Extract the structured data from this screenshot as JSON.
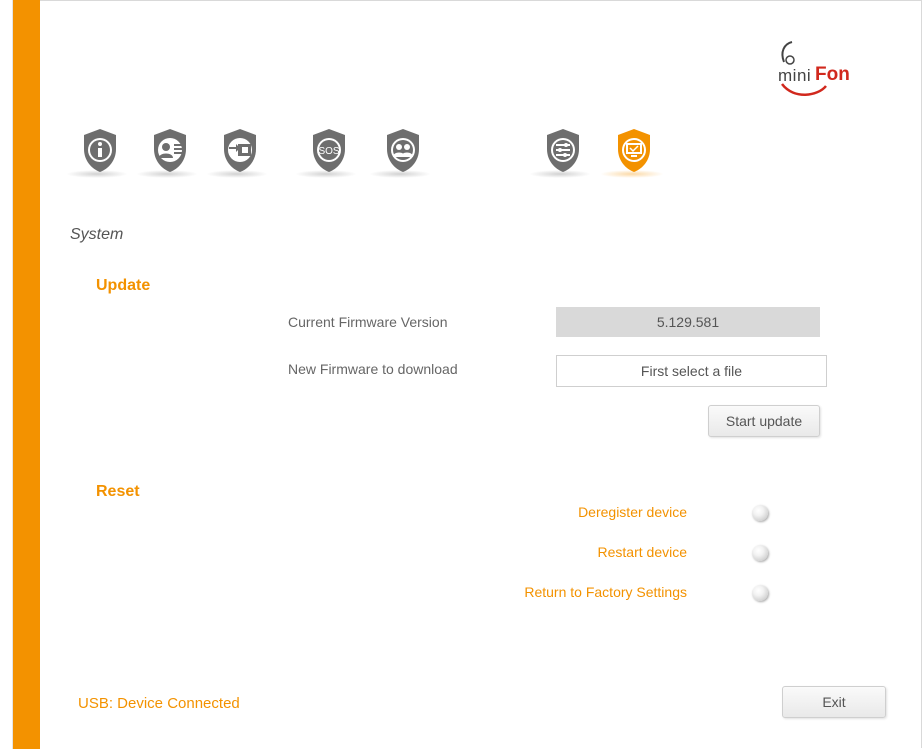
{
  "logo": {
    "mini": "mini",
    "fon": "Fon"
  },
  "nav": [
    {
      "name": "info",
      "icon": "info-icon"
    },
    {
      "name": "contacts",
      "icon": "contact-list-icon"
    },
    {
      "name": "transfer",
      "icon": "transfer-icon"
    },
    {
      "name": "sos",
      "icon": "sos-icon",
      "text": "SOS"
    },
    {
      "name": "users",
      "icon": "users-icon"
    },
    {
      "name": "settings",
      "icon": "sliders-icon"
    },
    {
      "name": "system",
      "icon": "monitor-check-icon",
      "active": true
    }
  ],
  "colors": {
    "accent": "#f39200",
    "icon_gray": "#6e6e6e",
    "logo_red": "#d1281d"
  },
  "page": {
    "title": "System"
  },
  "update": {
    "heading": "Update",
    "current_label": "Current Firmware Version",
    "current_value": "5.129.581",
    "new_label": "New Firmware to download",
    "file_placeholder": "First select a file",
    "start_button": "Start update"
  },
  "reset": {
    "heading": "Reset",
    "options": [
      {
        "label": "Deregister device"
      },
      {
        "label": "Restart device"
      },
      {
        "label": "Return to Factory Settings"
      }
    ]
  },
  "status": {
    "text": "USB: Device Connected"
  },
  "exit_button": "Exit"
}
